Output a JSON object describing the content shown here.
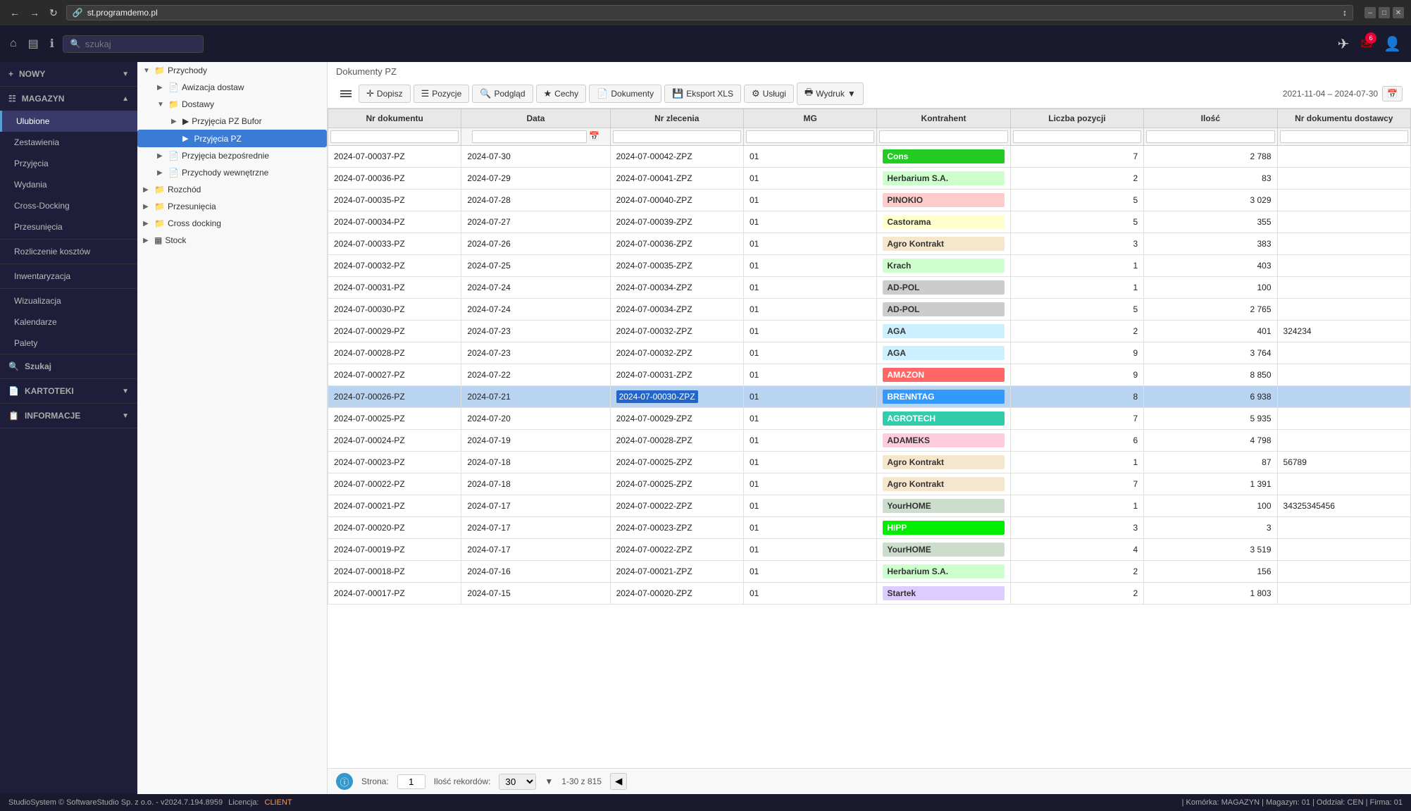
{
  "browser": {
    "url": "st.programdemo.pl",
    "title": "st.programdemo.pl"
  },
  "header": {
    "search_placeholder": "szukaj",
    "notification_count": "6"
  },
  "sidebar": {
    "nowy_label": "NOWY",
    "magazyn_label": "MAGAZYN",
    "items": [
      {
        "id": "ulubione",
        "label": "Ulubione",
        "active": true
      },
      {
        "id": "zestawienia",
        "label": "Zestawienia"
      },
      {
        "id": "przyjecia",
        "label": "Przyjęcia"
      },
      {
        "id": "wydania",
        "label": "Wydania"
      },
      {
        "id": "cross-docking",
        "label": "Cross-Docking"
      },
      {
        "id": "przesuniecia",
        "label": "Przesunięcia"
      },
      {
        "id": "rozliczenie",
        "label": "Rozliczenie kosztów"
      },
      {
        "id": "inwentaryzacja",
        "label": "Inwentaryzacja"
      },
      {
        "id": "wizualizacja",
        "label": "Wizualizacja"
      },
      {
        "id": "kalendarze",
        "label": "Kalendarze"
      },
      {
        "id": "palety",
        "label": "Palety"
      }
    ],
    "szukaj_label": "Szukaj",
    "kartoteki_label": "KARTOTEKI",
    "informacje_label": "INFORMACJE"
  },
  "tree": {
    "nodes": [
      {
        "id": "przychody",
        "label": "Przychody",
        "level": 0,
        "expanded": true,
        "icon": "folder"
      },
      {
        "id": "awizacja",
        "label": "Awizacja dostaw",
        "level": 1,
        "expanded": false,
        "icon": "doc"
      },
      {
        "id": "dostawy",
        "label": "Dostawy",
        "level": 1,
        "expanded": true,
        "icon": "folder"
      },
      {
        "id": "przyjecia-pz-bufor",
        "label": "Przyjęcia PZ Bufor",
        "level": 2,
        "expanded": false,
        "icon": "play-doc"
      },
      {
        "id": "przyjecia-pz",
        "label": "Przyjęcia PZ",
        "level": 2,
        "expanded": false,
        "icon": "play-doc",
        "active": true
      },
      {
        "id": "przyjecia-bezposrednie",
        "label": "Przyjęcia bezpośrednie",
        "level": 1,
        "expanded": false,
        "icon": "doc"
      },
      {
        "id": "przychody-wewnetrzne",
        "label": "Przychody wewnętrzne",
        "level": 1,
        "expanded": false,
        "icon": "doc"
      },
      {
        "id": "rozchod",
        "label": "Rozchód",
        "level": 0,
        "expanded": false,
        "icon": "folder"
      },
      {
        "id": "przesuniecia-tree",
        "label": "Przesunięcia",
        "level": 0,
        "expanded": false,
        "icon": "folder"
      },
      {
        "id": "cross-docking-tree",
        "label": "Cross docking",
        "level": 0,
        "expanded": false,
        "icon": "folder"
      },
      {
        "id": "stock",
        "label": "Stock",
        "level": 0,
        "expanded": false,
        "icon": "grid"
      }
    ]
  },
  "content": {
    "title": "Dokumenty PZ",
    "toolbar": {
      "dopisz": "Dopisz",
      "pozycje": "Pozycje",
      "podglad": "Podgląd",
      "cechy": "Cechy",
      "dokumenty": "Dokumenty",
      "eksport_xls": "Eksport XLS",
      "uslugi": "Usługi",
      "wydruk": "Wydruk",
      "date_range": "2021-11-04 – 2024-07-30"
    },
    "table": {
      "columns": [
        "Nr dokumentu",
        "Data",
        "Nr zlecenia",
        "MG",
        "Kontrahent",
        "Liczba pozycji",
        "Ilość",
        "Nr dokumentu dostawcy"
      ],
      "rows": [
        {
          "nr_dok": "2024-07-00037-PZ",
          "data": "2024-07-30",
          "nr_zlecenia": "2024-07-00042-ZPZ",
          "mg": "01",
          "kontrahent": "Cons",
          "k_class": "k-green",
          "lp": "7",
          "ilosc": "2 788",
          "nr_dok_dostawcy": ""
        },
        {
          "nr_dok": "2024-07-00036-PZ",
          "data": "2024-07-29",
          "nr_zlecenia": "2024-07-00041-ZPZ",
          "mg": "01",
          "kontrahent": "Herbarium S.A.",
          "k_class": "k-green2",
          "lp": "2",
          "ilosc": "83",
          "nr_dok_dostawcy": ""
        },
        {
          "nr_dok": "2024-07-00035-PZ",
          "data": "2024-07-28",
          "nr_zlecenia": "2024-07-00040-ZPZ",
          "mg": "01",
          "kontrahent": "PINOKIO",
          "k_class": "k-pink",
          "lp": "5",
          "ilosc": "3 029",
          "nr_dok_dostawcy": ""
        },
        {
          "nr_dok": "2024-07-00034-PZ",
          "data": "2024-07-27",
          "nr_zlecenia": "2024-07-00039-ZPZ",
          "mg": "01",
          "kontrahent": "Castorama",
          "k_class": "k-yellow",
          "lp": "5",
          "ilosc": "355",
          "nr_dok_dostawcy": ""
        },
        {
          "nr_dok": "2024-07-00033-PZ",
          "data": "2024-07-26",
          "nr_zlecenia": "2024-07-00036-ZPZ",
          "mg": "01",
          "kontrahent": "Agro Kontrakt",
          "k_class": "k-beige",
          "lp": "3",
          "ilosc": "383",
          "nr_dok_dostawcy": ""
        },
        {
          "nr_dok": "2024-07-00032-PZ",
          "data": "2024-07-25",
          "nr_zlecenia": "2024-07-00035-ZPZ",
          "mg": "01",
          "kontrahent": "Krach",
          "k_class": "k-lightgreen",
          "lp": "1",
          "ilosc": "403",
          "nr_dok_dostawcy": ""
        },
        {
          "nr_dok": "2024-07-00031-PZ",
          "data": "2024-07-24",
          "nr_zlecenia": "2024-07-00034-ZPZ",
          "mg": "01",
          "kontrahent": "AD-POL",
          "k_class": "k-gray",
          "lp": "1",
          "ilosc": "100",
          "nr_dok_dostawcy": ""
        },
        {
          "nr_dok": "2024-07-00030-PZ",
          "data": "2024-07-24",
          "nr_zlecenia": "2024-07-00034-ZPZ",
          "mg": "01",
          "kontrahent": "AD-POL",
          "k_class": "k-gray",
          "lp": "5",
          "ilosc": "2 765",
          "nr_dok_dostawcy": ""
        },
        {
          "nr_dok": "2024-07-00029-PZ",
          "data": "2024-07-23",
          "nr_zlecenia": "2024-07-00032-ZPZ",
          "mg": "01",
          "kontrahent": "AGA",
          "k_class": "k-lightblue",
          "lp": "2",
          "ilosc": "401",
          "nr_dok_dostawcy": "324234"
        },
        {
          "nr_dok": "2024-07-00028-PZ",
          "data": "2024-07-23",
          "nr_zlecenia": "2024-07-00032-ZPZ",
          "mg": "01",
          "kontrahent": "AGA",
          "k_class": "k-lightblue",
          "lp": "9",
          "ilosc": "3 764",
          "nr_dok_dostawcy": ""
        },
        {
          "nr_dok": "2024-07-00027-PZ",
          "data": "2024-07-22",
          "nr_zlecenia": "2024-07-00031-ZPZ",
          "mg": "01",
          "kontrahent": "AMAZON",
          "k_class": "k-red",
          "lp": "9",
          "ilosc": "8 850",
          "nr_dok_dostawcy": ""
        },
        {
          "nr_dok": "2024-07-00026-PZ",
          "data": "2024-07-21",
          "nr_zlecenia": "2024-07-00030-ZPZ",
          "mg": "01",
          "kontrahent": "BRENNTAG",
          "k_class": "k-blue",
          "lp": "8",
          "ilosc": "6 938",
          "nr_dok_dostawcy": "",
          "selected": true
        },
        {
          "nr_dok": "2024-07-00025-PZ",
          "data": "2024-07-20",
          "nr_zlecenia": "2024-07-00029-ZPZ",
          "mg": "01",
          "kontrahent": "AGROTECH",
          "k_class": "k-teal",
          "lp": "7",
          "ilosc": "5 935",
          "nr_dok_dostawcy": ""
        },
        {
          "nr_dok": "2024-07-00024-PZ",
          "data": "2024-07-19",
          "nr_zlecenia": "2024-07-00028-ZPZ",
          "mg": "01",
          "kontrahent": "ADAMEKS",
          "k_class": "k-lightpink",
          "lp": "6",
          "ilosc": "4 798",
          "nr_dok_dostawcy": ""
        },
        {
          "nr_dok": "2024-07-00023-PZ",
          "data": "2024-07-18",
          "nr_zlecenia": "2024-07-00025-ZPZ",
          "mg": "01",
          "kontrahent": "Agro Kontrakt",
          "k_class": "k-beige",
          "lp": "1",
          "ilosc": "87",
          "nr_dok_dostawcy": "56789"
        },
        {
          "nr_dok": "2024-07-00022-PZ",
          "data": "2024-07-18",
          "nr_zlecenia": "2024-07-00025-ZPZ",
          "mg": "01",
          "kontrahent": "Agro Kontrakt",
          "k_class": "k-beige",
          "lp": "7",
          "ilosc": "1 391",
          "nr_dok_dostawcy": ""
        },
        {
          "nr_dok": "2024-07-00021-PZ",
          "data": "2024-07-17",
          "nr_zlecenia": "2024-07-00022-ZPZ",
          "mg": "01",
          "kontrahent": "YourHOME",
          "k_class": "k-sage",
          "lp": "1",
          "ilosc": "100",
          "nr_dok_dostawcy": "34325345456"
        },
        {
          "nr_dok": "2024-07-00020-PZ",
          "data": "2024-07-17",
          "nr_zlecenia": "2024-07-00023-ZPZ",
          "mg": "01",
          "kontrahent": "HIPP",
          "k_class": "k-brightgreen",
          "lp": "3",
          "ilosc": "3",
          "nr_dok_dostawcy": ""
        },
        {
          "nr_dok": "2024-07-00019-PZ",
          "data": "2024-07-17",
          "nr_zlecenia": "2024-07-00022-ZPZ",
          "mg": "01",
          "kontrahent": "YourHOME",
          "k_class": "k-sage",
          "lp": "4",
          "ilosc": "3 519",
          "nr_dok_dostawcy": ""
        },
        {
          "nr_dok": "2024-07-00018-PZ",
          "data": "2024-07-16",
          "nr_zlecenia": "2024-07-00021-ZPZ",
          "mg": "01",
          "kontrahent": "Herbarium S.A.",
          "k_class": "k-green2",
          "lp": "2",
          "ilosc": "156",
          "nr_dok_dostawcy": ""
        },
        {
          "nr_dok": "2024-07-00017-PZ",
          "data": "2024-07-15",
          "nr_zlecenia": "2024-07-00020-ZPZ",
          "mg": "01",
          "kontrahent": "Startek",
          "k_class": "k-lavender",
          "lp": "2",
          "ilosc": "1 803",
          "nr_dok_dostawcy": ""
        }
      ]
    },
    "pagination": {
      "page_label": "Strona:",
      "page_value": "1",
      "records_label": "Ilość rekordów:",
      "records_value": "30",
      "range": "1-30 z 815"
    }
  },
  "status_bar": {
    "copyright": "StudioSystem © SoftwareStudio Sp. z o.o. - v2024.7.194.8959",
    "license_label": "Licencja:",
    "license_value": "CLIENT",
    "right": "| Komórka: MAGAZYN | Magazyn: 01 | Oddział: CEN | Firma: 01"
  }
}
